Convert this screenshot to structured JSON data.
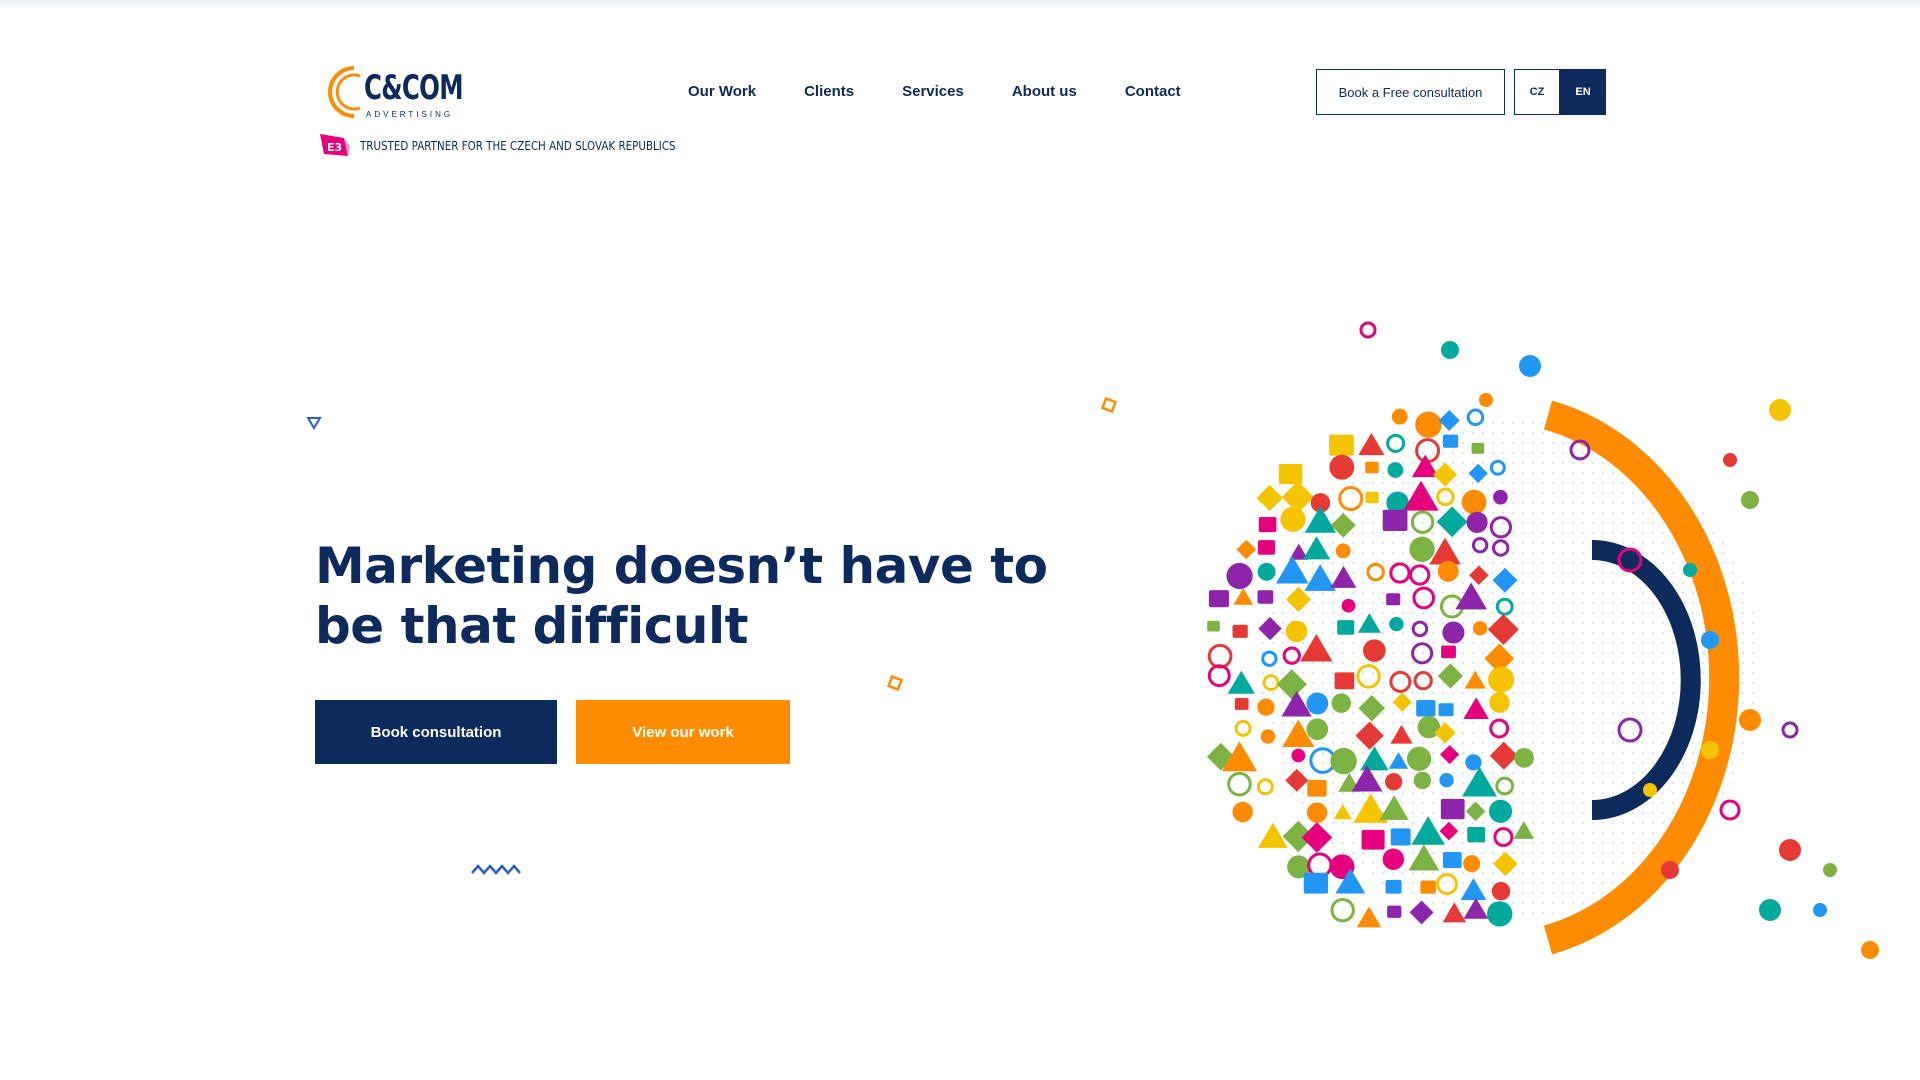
{
  "brand": {
    "logo_text": "C&COM",
    "logo_sub": "ADVERTISING",
    "trusted_badge": "E3",
    "trusted_text": "TRUSTED PARTNER FOR THE CZECH AND SLOVAK REPUBLICS"
  },
  "nav": {
    "items": [
      {
        "label": "Our Work"
      },
      {
        "label": "Clients"
      },
      {
        "label": "Services"
      },
      {
        "label": "About us"
      },
      {
        "label": "Contact"
      }
    ]
  },
  "header": {
    "consult_label": "Book a Free consultation",
    "lang_cz": "CZ",
    "lang_en": "EN"
  },
  "hero": {
    "title": "Marketing doesn’t have to be that difficult",
    "primary_button": "Book consultation",
    "secondary_button": "View our work"
  },
  "colors": {
    "navy": "#0d2a5c",
    "orange": "#ff8c00",
    "accent_palette": [
      "#e6007e",
      "#00a99d",
      "#2196f3",
      "#ff8c00",
      "#8e24aa",
      "#f5c400",
      "#e53935",
      "#7cb342"
    ]
  },
  "icons": {
    "art": "marketing-icons-head-illustration"
  }
}
